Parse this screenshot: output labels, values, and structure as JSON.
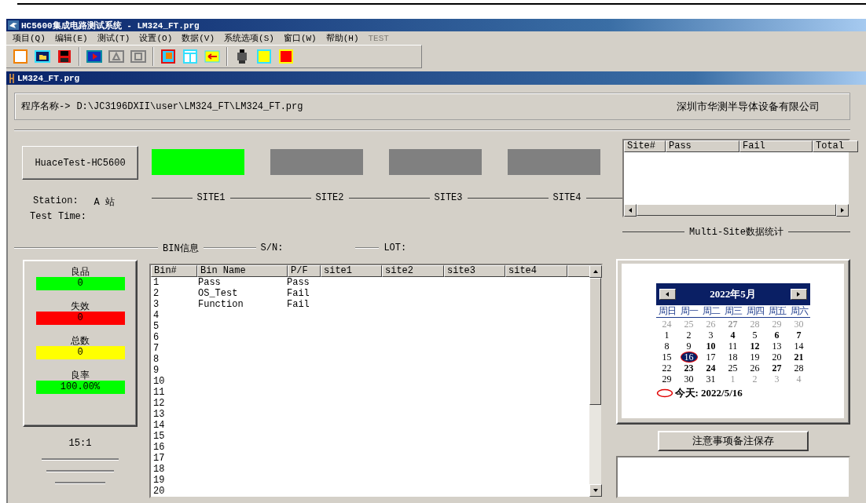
{
  "window": {
    "title": "HC5600集成电路测试系统 - LM324_FT.prg"
  },
  "menu": [
    {
      "label": "项目(Q)",
      "disabled": false
    },
    {
      "label": "编辑(E)",
      "disabled": false
    },
    {
      "label": "测试(T)",
      "disabled": false
    },
    {
      "label": "设置(O)",
      "disabled": false
    },
    {
      "label": "数据(V)",
      "disabled": false
    },
    {
      "label": "系统选项(S)",
      "disabled": false
    },
    {
      "label": "窗口(W)",
      "disabled": false
    },
    {
      "label": "帮助(H)",
      "disabled": false
    },
    {
      "label": "TEST",
      "disabled": true
    }
  ],
  "child_window": {
    "title": "LM324_FT.prg"
  },
  "program": {
    "label": "程序名称->",
    "path": "D:\\JC3196DXII\\user\\LM324_FT\\LM324_FT.prg",
    "company": "深圳市华测半导体设备有限公司"
  },
  "tester_button": "HuaceTest-HC5600",
  "sites": [
    {
      "label": "SITE1",
      "color": "#00ff00"
    },
    {
      "label": "SITE2",
      "color": "#808080"
    },
    {
      "label": "SITE3",
      "color": "#808080"
    },
    {
      "label": "SITE4",
      "color": "#808080"
    }
  ],
  "station": {
    "label": "Station:",
    "value": "A 站"
  },
  "test_time": {
    "label": "Test Time:"
  },
  "multi_site": {
    "columns": [
      "Site#",
      "Pass",
      "Fail",
      "Total"
    ],
    "caption": "Multi-Site数据统计"
  },
  "bin_section": {
    "caption": "BIN信息",
    "sn_label": "S/N:",
    "lot_label": "LOT:"
  },
  "counters": [
    {
      "label": "良品",
      "value": "0",
      "color": "#00ff00"
    },
    {
      "label": "失效",
      "value": "0",
      "color": "#ff0000"
    },
    {
      "label": "总数",
      "value": "0",
      "color": "#ffff00"
    },
    {
      "label": "良率",
      "value": "100.00%",
      "color": "#00ff00"
    }
  ],
  "ratio": "15:1",
  "bin_table": {
    "columns": [
      "Bin#",
      "Bin Name",
      "P/F",
      "site1",
      "site2",
      "site3",
      "site4"
    ],
    "rows": [
      {
        "bin": "1",
        "name": "Pass",
        "pf": "Pass"
      },
      {
        "bin": "2",
        "name": "OS_Test",
        "pf": "Fail"
      },
      {
        "bin": "3",
        "name": "Function",
        "pf": "Fail"
      },
      {
        "bin": "4"
      },
      {
        "bin": "5"
      },
      {
        "bin": "6"
      },
      {
        "bin": "7"
      },
      {
        "bin": "8"
      },
      {
        "bin": "9"
      },
      {
        "bin": "10"
      },
      {
        "bin": "11"
      },
      {
        "bin": "12"
      },
      {
        "bin": "13"
      },
      {
        "bin": "14"
      },
      {
        "bin": "15"
      },
      {
        "bin": "16"
      },
      {
        "bin": "17"
      },
      {
        "bin": "18"
      },
      {
        "bin": "19"
      },
      {
        "bin": "20"
      }
    ]
  },
  "calendar": {
    "month": "2022年5月",
    "weekdays": [
      "周日",
      "周一",
      "周二",
      "周三",
      "周四",
      "周五",
      "周六"
    ],
    "weeks": [
      [
        {
          "d": "24",
          "muted": true,
          "bold": false,
          "selected": false
        },
        {
          "d": "25",
          "muted": true,
          "bold": false,
          "selected": false
        },
        {
          "d": "26",
          "muted": true,
          "bold": false,
          "selected": false
        },
        {
          "d": "27",
          "muted": true,
          "bold": true,
          "selected": false
        },
        {
          "d": "28",
          "muted": true,
          "bold": false,
          "selected": false
        },
        {
          "d": "29",
          "muted": true,
          "bold": false,
          "selected": false
        },
        {
          "d": "30",
          "muted": true,
          "bold": false,
          "selected": false
        }
      ],
      [
        {
          "d": "1",
          "muted": false,
          "bold": false,
          "selected": false
        },
        {
          "d": "2",
          "muted": false,
          "bold": false,
          "selected": false
        },
        {
          "d": "3",
          "muted": false,
          "bold": false,
          "selected": false
        },
        {
          "d": "4",
          "muted": false,
          "bold": true,
          "selected": false
        },
        {
          "d": "5",
          "muted": false,
          "bold": false,
          "selected": false
        },
        {
          "d": "6",
          "muted": false,
          "bold": true,
          "selected": false
        },
        {
          "d": "7",
          "muted": false,
          "bold": true,
          "selected": false
        }
      ],
      [
        {
          "d": "8",
          "muted": false,
          "bold": false,
          "selected": false
        },
        {
          "d": "9",
          "muted": false,
          "bold": false,
          "selected": false
        },
        {
          "d": "10",
          "muted": false,
          "bold": true,
          "selected": false
        },
        {
          "d": "11",
          "muted": false,
          "bold": false,
          "selected": false
        },
        {
          "d": "12",
          "muted": false,
          "bold": true,
          "selected": false
        },
        {
          "d": "13",
          "muted": false,
          "bold": false,
          "selected": false
        },
        {
          "d": "14",
          "muted": false,
          "bold": false,
          "selected": false
        }
      ],
      [
        {
          "d": "15",
          "muted": false,
          "bold": false,
          "selected": false
        },
        {
          "d": "16",
          "muted": false,
          "bold": false,
          "selected": true
        },
        {
          "d": "17",
          "muted": false,
          "bold": false,
          "selected": false
        },
        {
          "d": "18",
          "muted": false,
          "bold": false,
          "selected": false
        },
        {
          "d": "19",
          "muted": false,
          "bold": false,
          "selected": false
        },
        {
          "d": "20",
          "muted": false,
          "bold": false,
          "selected": false
        },
        {
          "d": "21",
          "muted": false,
          "bold": true,
          "selected": false
        }
      ],
      [
        {
          "d": "22",
          "muted": false,
          "bold": false,
          "selected": false
        },
        {
          "d": "23",
          "muted": false,
          "bold": true,
          "selected": false
        },
        {
          "d": "24",
          "muted": false,
          "bold": true,
          "selected": false
        },
        {
          "d": "25",
          "muted": false,
          "bold": false,
          "selected": false
        },
        {
          "d": "26",
          "muted": false,
          "bold": false,
          "selected": false
        },
        {
          "d": "27",
          "muted": false,
          "bold": true,
          "selected": false
        },
        {
          "d": "28",
          "muted": false,
          "bold": false,
          "selected": false
        }
      ],
      [
        {
          "d": "29",
          "muted": false,
          "bold": false,
          "selected": false
        },
        {
          "d": "30",
          "muted": false,
          "bold": false,
          "selected": false
        },
        {
          "d": "31",
          "muted": false,
          "bold": false,
          "selected": false
        },
        {
          "d": "1",
          "muted": true,
          "bold": false,
          "selected": false
        },
        {
          "d": "2",
          "muted": true,
          "bold": false,
          "selected": false
        },
        {
          "d": "3",
          "muted": true,
          "bold": false,
          "selected": false
        },
        {
          "d": "4",
          "muted": true,
          "bold": false,
          "selected": false
        }
      ]
    ],
    "today": "今天: 2022/5/16"
  },
  "save_button": "注意事项备注保存"
}
